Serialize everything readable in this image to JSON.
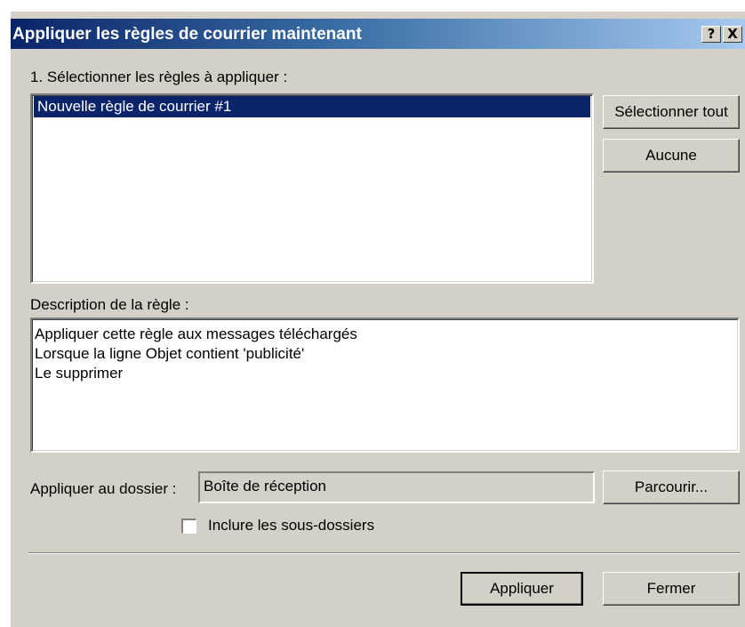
{
  "window": {
    "title": "Appliquer les règles de courrier maintenant",
    "help_label": "?",
    "close_label": "X"
  },
  "rules": {
    "label": "1. Sélectionner les règles à appliquer :",
    "items": [
      "Nouvelle règle de courrier #1"
    ],
    "selected_index": 0,
    "select_all_label": "Sélectionner tout",
    "none_label": "Aucune"
  },
  "description": {
    "label": "Description de la règle :",
    "lines": [
      "Appliquer cette règle aux messages téléchargés",
      "Lorsque la ligne Objet contient 'publicité'",
      "Le supprimer"
    ]
  },
  "folder": {
    "label": "Appliquer au dossier :",
    "value": "Boîte de réception",
    "browse_label": "Parcourir...",
    "include_subfolders_label": "Inclure les sous-dossiers",
    "include_subfolders_checked": false
  },
  "footer": {
    "apply_label": "Appliquer",
    "close_label": "Fermer"
  },
  "colors": {
    "title_bar_start": "#0a246a",
    "title_bar_end": "#a6caf0",
    "dialog_bg": "#d4d0c8",
    "selection_bg": "#0a246a"
  }
}
